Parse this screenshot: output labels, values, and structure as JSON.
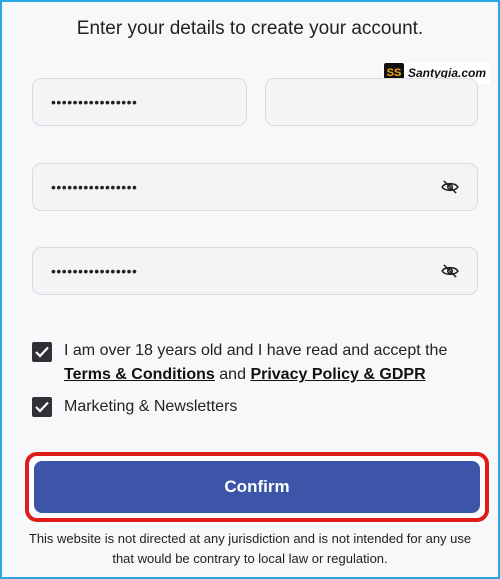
{
  "heading": "Enter your details to create your account.",
  "watermark": {
    "text": "Santygia.com",
    "logo": "SS"
  },
  "fields": {
    "first": {
      "value": "••••••••••••••••"
    },
    "second": {
      "value": ""
    },
    "password": {
      "value": "••••••••••••••••",
      "icon": "eye-slash-icon"
    },
    "confirm_password": {
      "value": "••••••••••••••••",
      "icon": "eye-slash-icon"
    }
  },
  "consent": {
    "text_before": "I am over 18 years old and I have read and accept the",
    "terms_link": "Terms & Conditions",
    "and": "and",
    "privacy_link": "Privacy Policy & GDPR",
    "checked": true
  },
  "marketing": {
    "label": "Marketing & Newsletters",
    "checked": true
  },
  "confirm_label": "Confirm",
  "disclaimer": "This website is not directed at any jurisdiction and is not intended for any use that would be contrary to local law or regulation.",
  "colors": {
    "accent": "#3d55a9",
    "highlight": "#e01b1b",
    "frame": "#2aa7df"
  }
}
